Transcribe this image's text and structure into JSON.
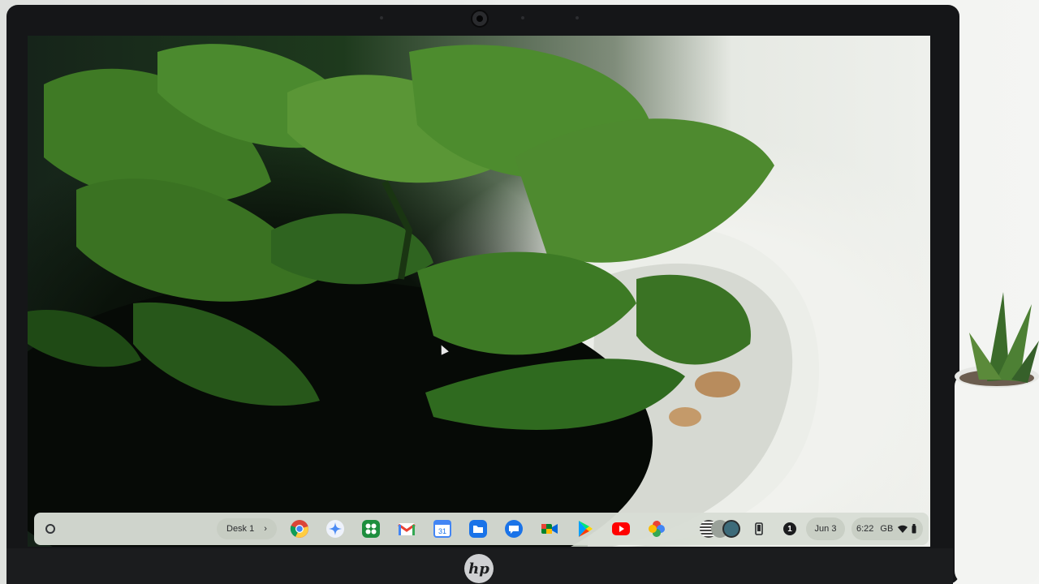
{
  "device": {
    "logo_text": "hp"
  },
  "shelf": {
    "desk_label": "Desk 1",
    "desk_chevron": "›",
    "apps": [
      {
        "name": "Chrome",
        "icon": "chrome-icon"
      },
      {
        "name": "Gemini",
        "icon": "gemini-icon"
      },
      {
        "name": "Google Workspace",
        "icon": "apps-grid-icon"
      },
      {
        "name": "Gmail",
        "icon": "gmail-icon"
      },
      {
        "name": "Calendar",
        "icon": "calendar-icon",
        "label": "31"
      },
      {
        "name": "Files",
        "icon": "files-icon"
      },
      {
        "name": "Messages",
        "icon": "messages-icon"
      },
      {
        "name": "Meet",
        "icon": "meet-icon"
      },
      {
        "name": "Play Store",
        "icon": "play-store-icon"
      },
      {
        "name": "YouTube",
        "icon": "youtube-icon"
      },
      {
        "name": "Photos",
        "icon": "photos-icon"
      }
    ],
    "tray": {
      "notification_count": "1",
      "date": "Jun 3",
      "time": "6:22",
      "locale": "GB"
    }
  },
  "colors": {
    "shelf_bg": "#d7ddd4",
    "chip_bg": "#c7cdc3",
    "bezel": "#151618"
  }
}
